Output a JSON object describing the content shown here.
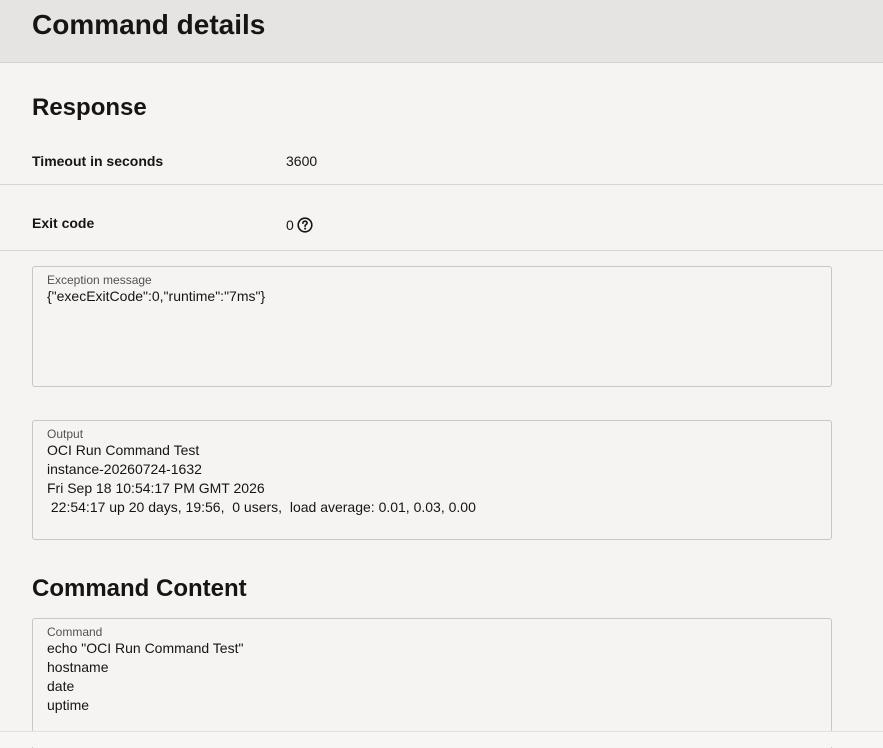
{
  "header": {
    "title": "Command details"
  },
  "response": {
    "title": "Response",
    "timeout": {
      "label": "Timeout in seconds",
      "value": "3600"
    },
    "exit_code": {
      "label": "Exit code",
      "value": "0",
      "help_icon": "question-circle-icon"
    },
    "exception": {
      "label": "Exception message",
      "lines": [
        "{\"execExitCode\":0,\"runtime\":\"7ms\"}"
      ]
    },
    "output": {
      "label": "Output",
      "lines": [
        "OCI Run Command Test",
        "instance-20260724-1632",
        "Fri Sep 18 10:54:17 PM GMT 2026",
        " 22:54:17 up 20 days, 19:56,  0 users,  load average: 0.01, 0.03, 0.00"
      ]
    }
  },
  "command_content": {
    "title": "Command Content",
    "command": {
      "label": "Command",
      "lines": [
        "echo \"OCI Run Command Test\"",
        "hostname",
        "date",
        "uptime"
      ]
    }
  }
}
